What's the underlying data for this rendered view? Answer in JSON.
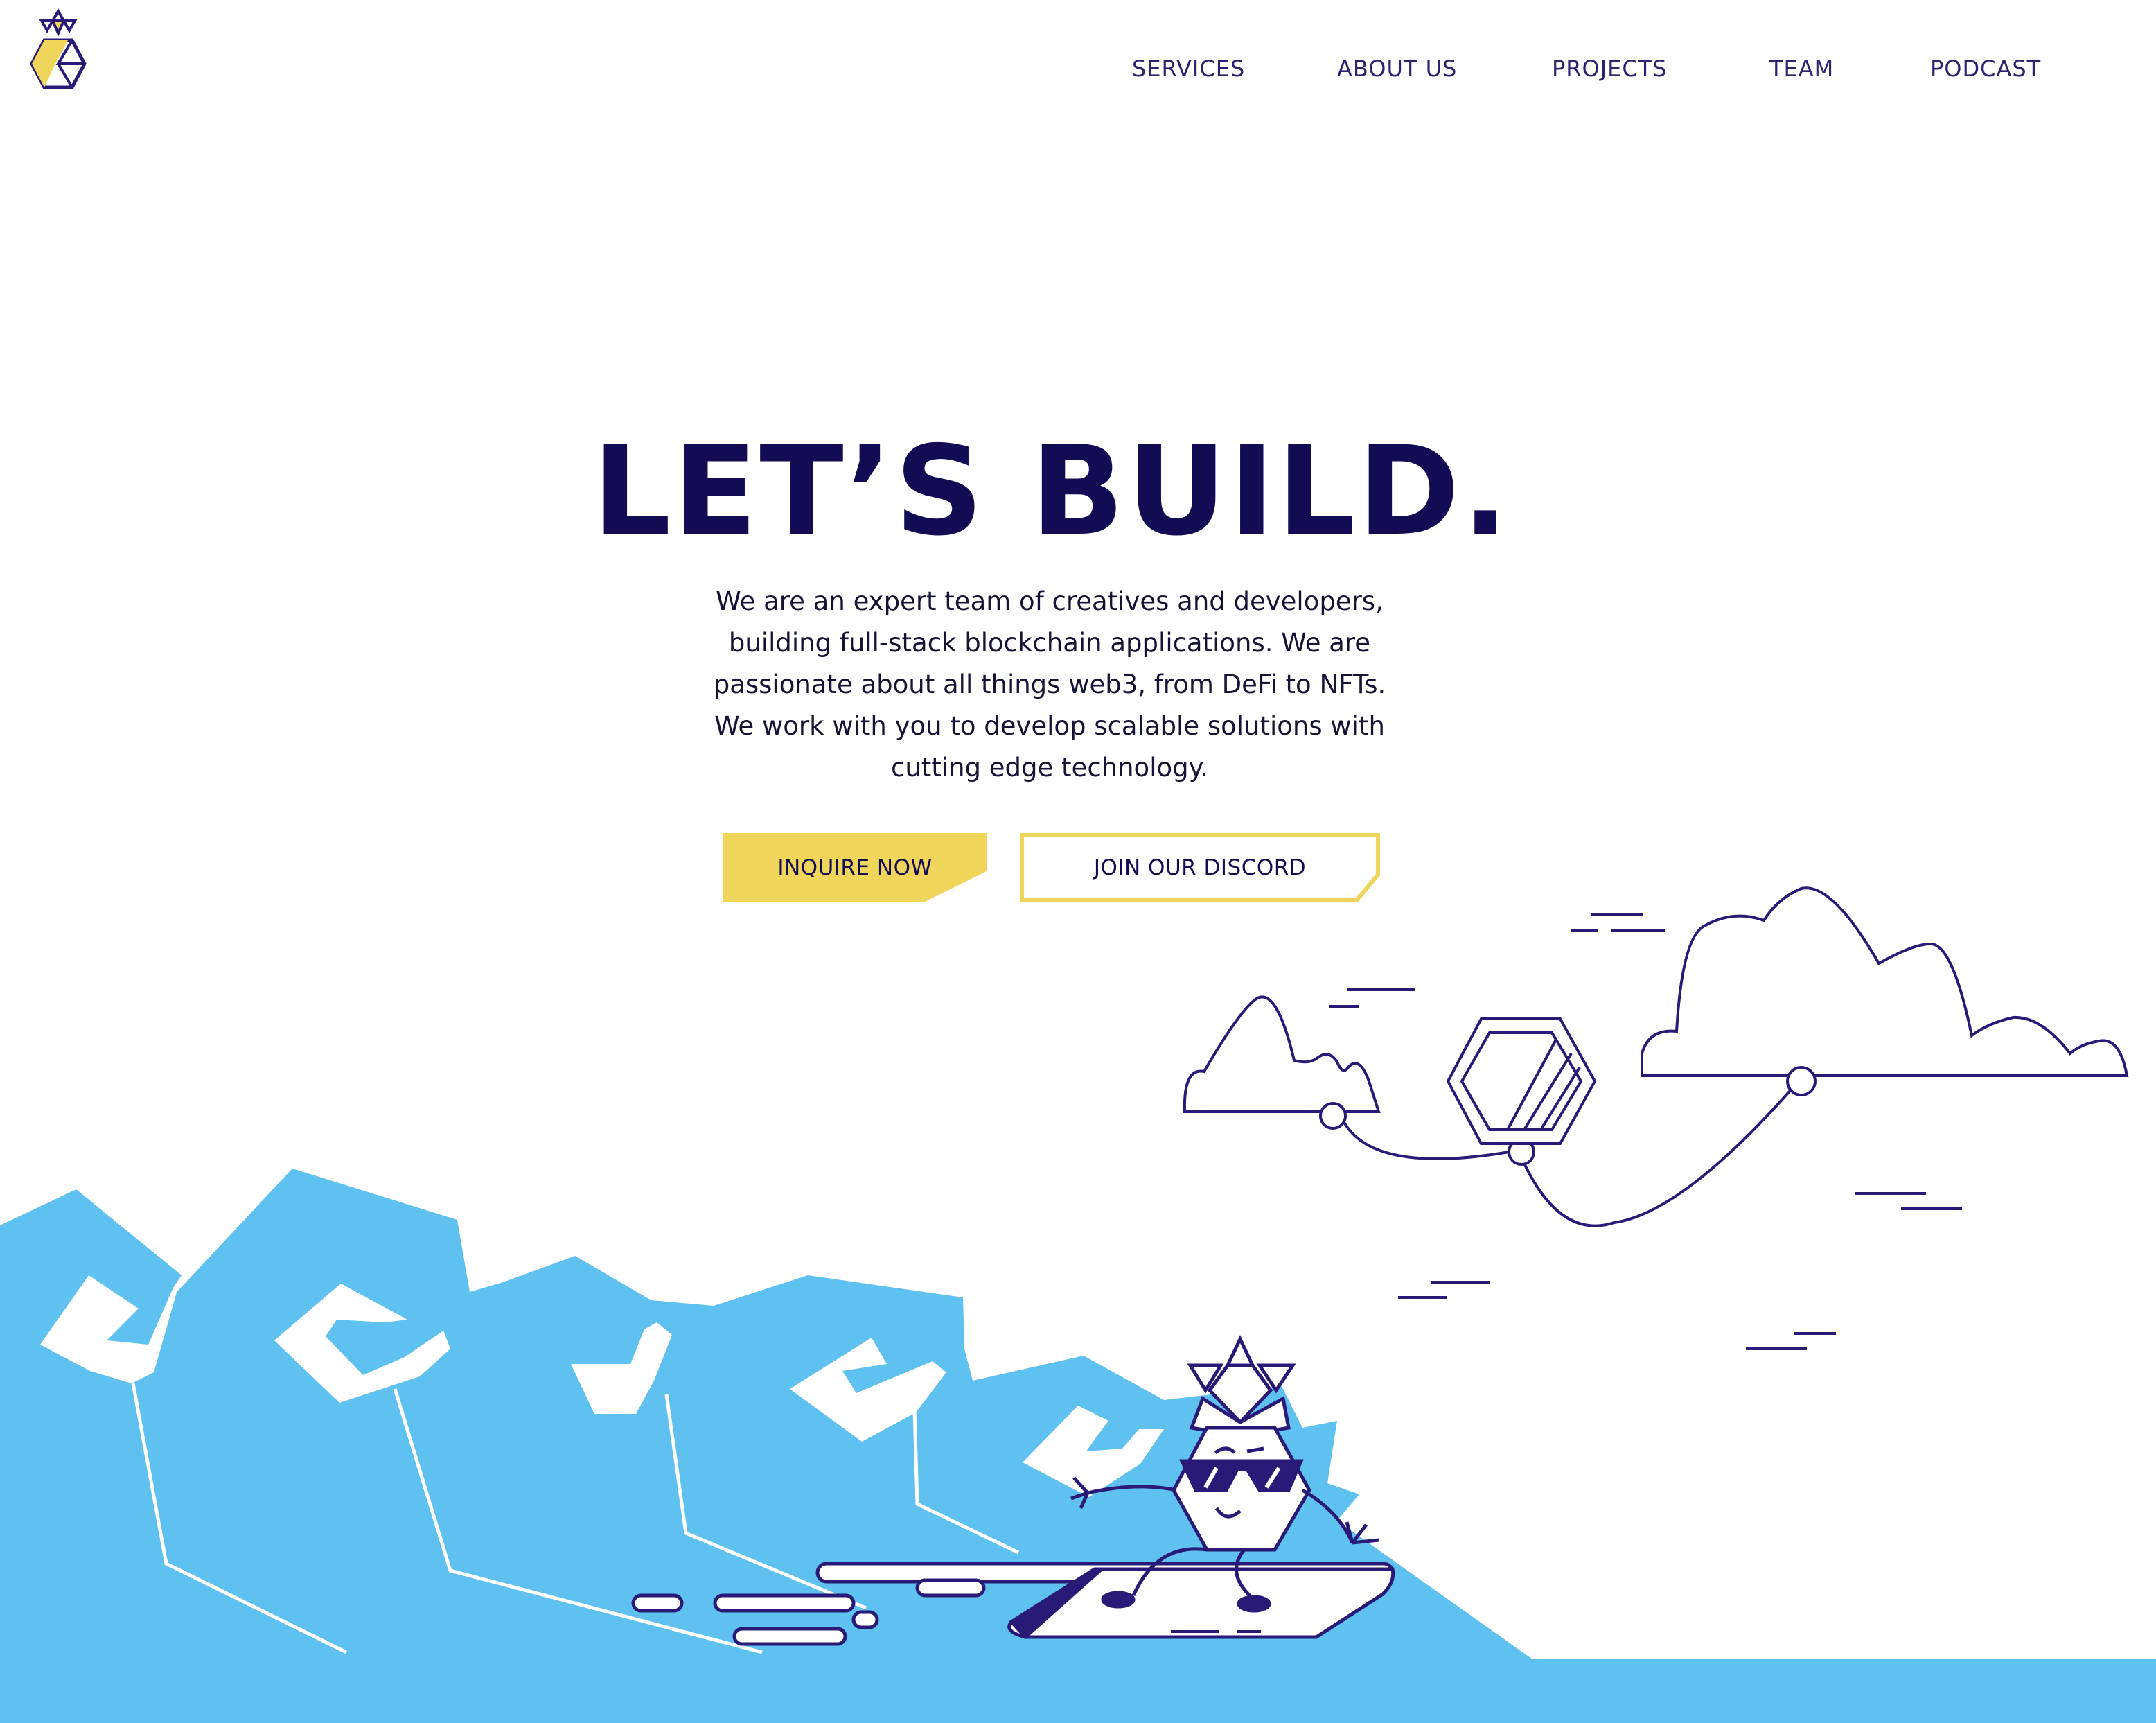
{
  "brand": {
    "logo_icon": "pineapple-hexagon-icon",
    "colors": {
      "navy": "#130c55",
      "yellow": "#efd55a",
      "sky": "#5ec1ef"
    }
  },
  "nav": {
    "items": [
      {
        "label": "SERVICES"
      },
      {
        "label": "ABOUT US"
      },
      {
        "label": "PROJECTS"
      },
      {
        "label": "TEAM"
      },
      {
        "label": "PODCAST"
      }
    ]
  },
  "hero": {
    "title": "LET’S BUILD.",
    "body": "We are an expert team of creatives and developers, building full-stack blockchain applications. We are passionate about all things web3, from DeFi to NFTs. We work with you to develop scalable solutions with cutting edge technology.",
    "primary_button": "INQUIRE NOW",
    "secondary_button": "JOIN OUR DISCORD"
  },
  "illustration": {
    "items": [
      "cloud-left-icon",
      "cloud-right-icon",
      "hexagon-kite-icon",
      "wave-mountains-icon",
      "pineapple-mascot-icon",
      "hoverboard-phone-icon"
    ]
  }
}
